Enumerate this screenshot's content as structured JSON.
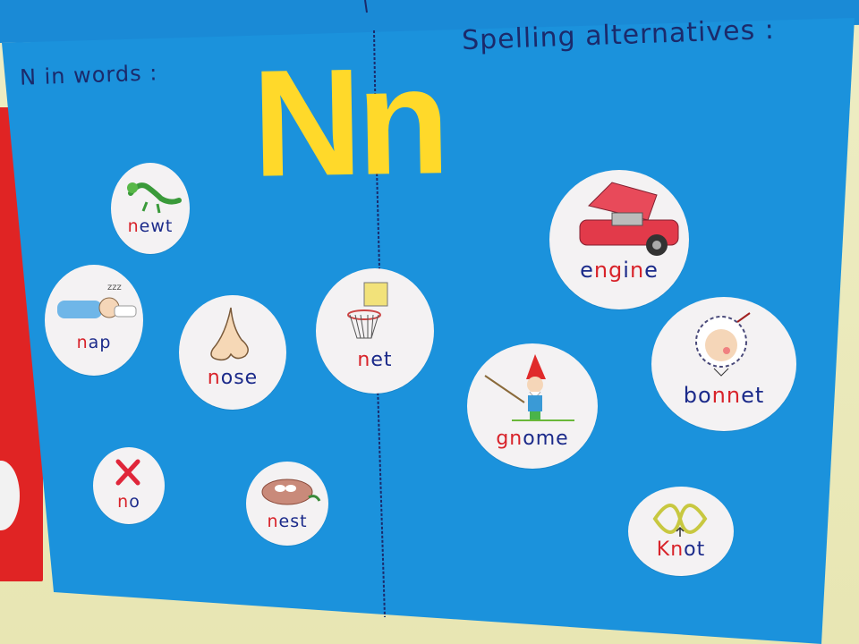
{
  "headings": {
    "left": "N in words :",
    "right": "Spelling alternatives :",
    "big_letters": "Nn"
  },
  "cards": {
    "newt": "newt",
    "nap": "nap",
    "nose": "nose",
    "net": "net",
    "no": "no",
    "nest": "nest",
    "engine": "engine",
    "gnome": "gnome",
    "bonnet": "bonnet",
    "knot": "Knot"
  },
  "colors": {
    "poster": "#1b92dc",
    "big_letters": "#ffd92a",
    "card": "#f4f2f3",
    "letter_n": "#d8232a",
    "letter_rest": "#1b2a8a",
    "wall": "#e9e8b8"
  }
}
